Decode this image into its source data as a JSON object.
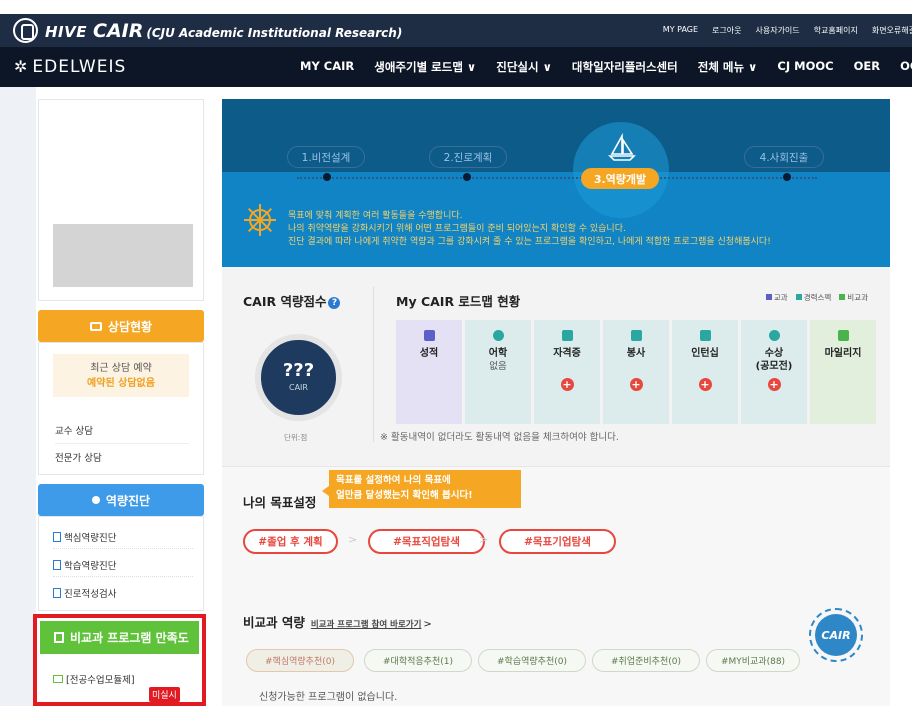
{
  "header": {
    "brand_hive": "HIVE",
    "brand_cair": "CAIR",
    "brand_sub": "(CJU Academic Institutional Research)",
    "utils": [
      "MY PAGE",
      "로그아웃",
      "사용자가이드",
      "학교홈페이지",
      "화면오류해결"
    ],
    "edelweis": "EDELWEIS",
    "nav": [
      "MY CAIR",
      "생애주기별 로드맵 ∨",
      "진단실시 ∨",
      "대학일자리플러스센터",
      "전체 메뉴 ∨",
      "CJ MOOC",
      "OER",
      "OCW"
    ]
  },
  "sidebar": {
    "consult_title": "상담현황",
    "recent_label": "최근 상담 예약",
    "recent_value": "예약된 상담없음",
    "links": [
      "교수 상담",
      "전문가 상담"
    ],
    "diagnosis_title": "역량진단",
    "diagnosis_items": [
      "핵심역량진단",
      "학습역량진단",
      "진로적성검사"
    ],
    "survey_title": "비교과 프로그램 만족도",
    "survey_item": "[전공수업모듈제]",
    "survey_badge": "미실시"
  },
  "banner": {
    "stages": [
      "1.비전설계",
      "2.진로계획",
      "3.역량개발",
      "4.사회진출"
    ],
    "active_stage": "3.역량개발",
    "lines": [
      "목표에 맞춰 계획한 여러 활동들을 수행합니다.",
      "나의 취약역량을 강화시키기 위해 어떤 프로그램들이 준비 되어있는지 확인할 수 있습니다.",
      "진단 결과에 따라 나에게 취약한 역량과 그를 강화시켜 줄 수 있는 프로그램을 확인하고, 나에게 적합한 프로그램을 신청해봅시다!"
    ]
  },
  "score": {
    "title": "CAIR 역량점수",
    "help": "?",
    "value": "???",
    "label": "CAIR",
    "unit": "단위:점"
  },
  "roadmap": {
    "title": "My CAIR 로드맵 현황",
    "legend": [
      {
        "label": "교과",
        "color": "#5b5fc7"
      },
      {
        "label": "경력스펙",
        "color": "#2aa7a0"
      },
      {
        "label": "비교과",
        "color": "#4bb34b"
      }
    ],
    "tiles": [
      {
        "label": "성적",
        "sub": "",
        "plus": false,
        "bg": "#e3e1f3",
        "icon": "#5b5fc7"
      },
      {
        "label": "어학",
        "sub": "없음",
        "plus": false,
        "bg": "#dcecec",
        "icon": "#2aa7a0"
      },
      {
        "label": "자격증",
        "sub": "",
        "plus": true,
        "bg": "#dcecec",
        "icon": "#2aa7a0"
      },
      {
        "label": "봉사",
        "sub": "",
        "plus": true,
        "bg": "#dcecec",
        "icon": "#2aa7a0"
      },
      {
        "label": "인턴십",
        "sub": "",
        "plus": true,
        "bg": "#dcecec",
        "icon": "#2aa7a0"
      },
      {
        "label": "수상",
        "sub": "(공모전)",
        "plus": true,
        "bg": "#dcecec",
        "icon": "#2aa7a0"
      },
      {
        "label": "마일리지",
        "sub": "",
        "plus": false,
        "bg": "#e2efdc",
        "icon": "#4bb34b"
      }
    ],
    "plus_symbol": "+",
    "notice": "※ 활동내역이 없더라도 활동내역 없음을 체크하여야 합니다."
  },
  "goal": {
    "title": "나의 목표설정",
    "tip_line1": "목표를 설정하여 나의 목표에",
    "tip_line2": "얼만큼 달성했는지 확인해 봅시다!",
    "pills": [
      "#졸업 후 계획",
      "#목표직업탐색",
      "#목표기업탐색"
    ],
    "separator": ">"
  },
  "compare": {
    "title": "비교과 역량",
    "link": "비교과 프로그램 참여 바로가기",
    "link_arrow": ">",
    "badge": "CAIR",
    "tabs": [
      "#핵심역량추천(0)",
      "#대학적응추천(1)",
      "#학습역량추천(0)",
      "#취업준비추천(0)",
      "#MY비교과(88)"
    ],
    "empty": "신청가능한 프로그램이 없습니다."
  },
  "colors": {
    "header_bg": "#1e2d44",
    "nav_bg": "#0d1626",
    "consult_accent": "#f5a623",
    "diagnosis_accent": "#3d9be9",
    "survey_accent": "#5fc23a",
    "highlight_border": "#e21b23",
    "goal_accent": "#e8473d"
  }
}
